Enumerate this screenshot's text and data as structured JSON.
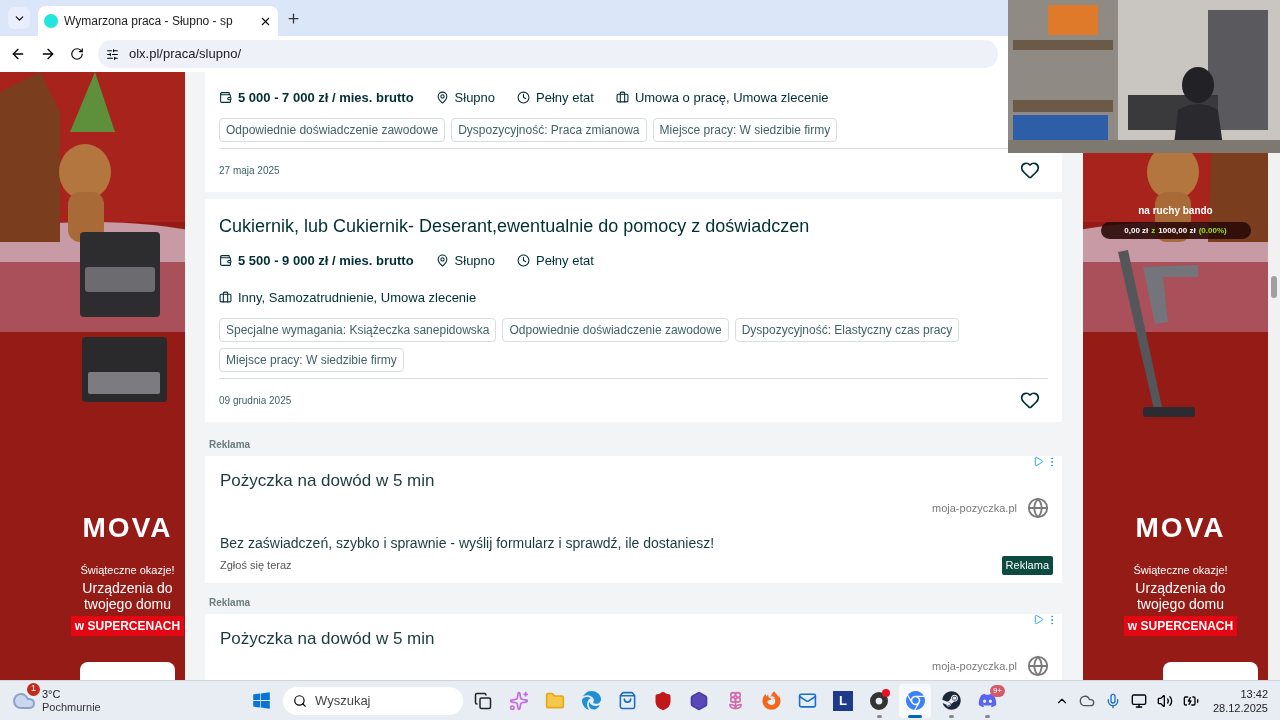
{
  "browser": {
    "tab_title": "Wymarzona praca - Słupno - sp",
    "url": "olx.pl/praca/slupno/"
  },
  "stream_overlay": {
    "title": "na ruchy bando",
    "amount": "0,00 zł",
    "of": "z",
    "goal": "1000,00 zł",
    "percent": "(0.00%)"
  },
  "side_ads": [
    {
      "brand": "MOVA",
      "tagline": "Świąteczne okazje!",
      "headline": "Urządzenia do twojego domu",
      "highlight": "w SUPERCENACH"
    },
    {
      "brand": "MOVA",
      "tagline": "Świąteczne okazje!",
      "headline": "Urządzenia do twojego domu",
      "highlight": "w SUPERCENACH"
    }
  ],
  "listings": [
    {
      "salary": "5 000 - 7 000 zł / mies. brutto",
      "location": "Słupno",
      "work_time": "Pełny etat",
      "contract": "Umowa o pracę, Umowa zlecenie",
      "tags": [
        "Odpowiednie doświadczenie zawodowe",
        "Dyspozycyjność: Praca zmianowa",
        "Miejsce pracy: W siedzibie firmy"
      ],
      "date": "27 maja 2025",
      "favorite": false
    },
    {
      "title": "Cukiernik, lub Cukiernik- Deserant,ewentualnie do pomocy z doświadczen",
      "salary": "5 500 - 9 000 zł / mies. brutto",
      "location": "Słupno",
      "work_time": "Pełny etat",
      "contract": "Inny, Samozatrudnienie, Umowa zlecenie",
      "tags": [
        "Specjalne wymagania: Książeczka sanepidowska",
        "Odpowiednie doświadczenie zawodowe",
        "Dyspozycyjność: Elastyczny czas pracy",
        "Miejsce pracy: W siedzibie firmy"
      ],
      "date": "09 grudnia 2025",
      "favorite": false
    }
  ],
  "ads": [
    {
      "label": "Reklama",
      "title": "Pożyczka na dowód w 5 min",
      "domain": "moja-pozyczka.pl",
      "description": "Bez zaświadczeń, szybko i sprawnie - wyślij formularz i sprawdź, ile dostaniesz!",
      "cta": "Zgłoś się teraz",
      "badge": "Reklama"
    },
    {
      "label": "Reklama",
      "title": "Pożyczka na dowód w 5 min",
      "domain": "moja-pozyczka.pl"
    }
  ],
  "taskbar": {
    "weather": {
      "badge": "1",
      "temperature": "3°C",
      "condition": "Pochmurnie"
    },
    "search": {
      "placeholder": "Wyszukaj"
    },
    "apps": [
      {
        "kind": "taskview",
        "running": false,
        "active": false
      },
      {
        "kind": "copilot",
        "running": false,
        "active": false
      },
      {
        "kind": "folder",
        "running": false,
        "active": false
      },
      {
        "kind": "edge",
        "running": false,
        "active": false
      },
      {
        "kind": "store",
        "running": false,
        "active": false
      },
      {
        "kind": "shield",
        "running": false,
        "active": false
      },
      {
        "kind": "hexagon",
        "running": false,
        "active": false
      },
      {
        "kind": "flower",
        "running": false,
        "active": false
      },
      {
        "kind": "firefox",
        "running": false,
        "active": false
      },
      {
        "kind": "mailbox",
        "running": false,
        "active": false
      },
      {
        "kind": "letter",
        "letter": "L",
        "running": false,
        "active": false
      },
      {
        "kind": "recorder",
        "running": true,
        "active": false,
        "notification": true
      },
      {
        "kind": "chrome",
        "running": true,
        "active": true
      },
      {
        "kind": "steam",
        "running": true,
        "active": false
      },
      {
        "kind": "discord",
        "running": true,
        "active": false,
        "badge": "9+"
      }
    ],
    "time": "13:42",
    "date": "28.12.2025"
  }
}
